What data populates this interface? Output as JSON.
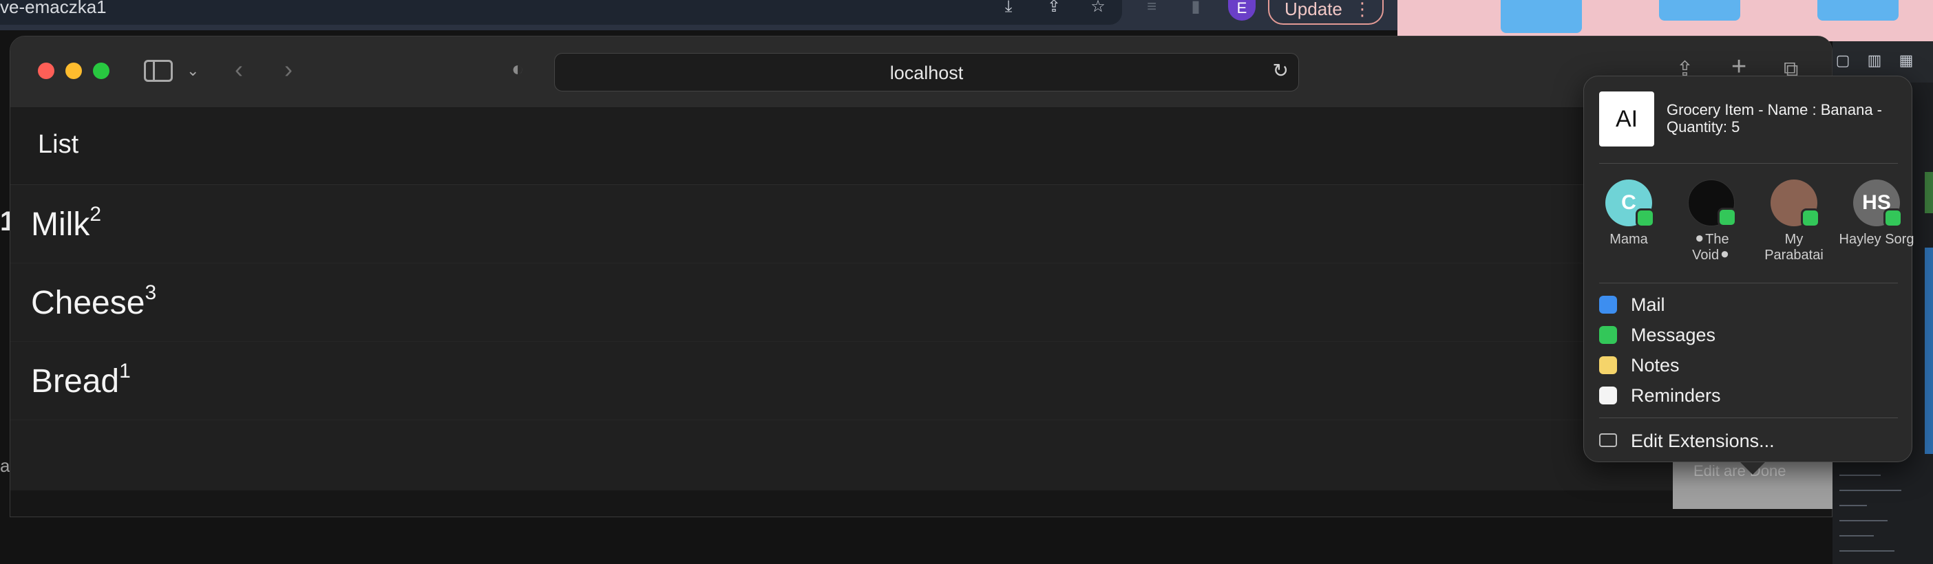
{
  "background": {
    "chrome_tab_title": "ve-emaczka1",
    "chrome_avatar_letter": "E",
    "chrome_update_label": "Update",
    "chrome_update_menu": "⋮",
    "left_stray_1": "1",
    "left_stray_2": "ac"
  },
  "safari": {
    "address": "localhost",
    "icons": {
      "sidebar": "sidebar-icon",
      "back": "chevron-left-icon",
      "forward": "chevron-right-icon",
      "privacy": "shield-icon",
      "reload": "reload-icon",
      "share": "share-icon",
      "new_tab": "plus-icon",
      "tabs": "tabs-icon"
    }
  },
  "page": {
    "title": "List",
    "items": [
      {
        "name": "Milk",
        "quantity": "2"
      },
      {
        "name": "Cheese",
        "quantity": "3"
      },
      {
        "name": "Bread",
        "quantity": "1"
      }
    ]
  },
  "share_popover": {
    "thumb_label": "AI",
    "title": "Grocery Item - Name : Banana - Quantity: 5",
    "contacts": [
      {
        "name": "Mama",
        "initials": "C",
        "color": "#6fd3d6"
      },
      {
        "name": "⚫The Void⚫",
        "initials": "",
        "color": "#0e0e0e"
      },
      {
        "name": "My Parabatai",
        "initials": "",
        "color": "#8a6252"
      },
      {
        "name": "Hayley Sorg",
        "initials": "HS",
        "color": "#6a6a6a"
      }
    ],
    "apps": [
      {
        "label": "Mail",
        "color": "#3d8ef0"
      },
      {
        "label": "Messages",
        "color": "#33c759"
      },
      {
        "label": "Notes",
        "color": "#f5d46a"
      },
      {
        "label": "Reminders",
        "color": "#f4f4f4"
      }
    ],
    "edit_extensions": "Edit Extensions..."
  },
  "ghost_strip_text": "Edit   are   Done"
}
